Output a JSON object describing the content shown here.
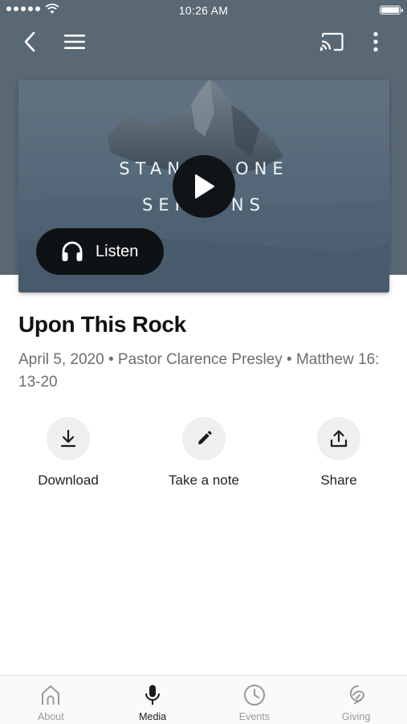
{
  "status_bar": {
    "time": "10:26 AM"
  },
  "hero": {
    "artwork_text": [
      "STANDALONE",
      "SERMONS"
    ],
    "listen_label": "Listen"
  },
  "sermon": {
    "title": "Upon This Rock",
    "meta": "April 5, 2020 • Pastor Clarence Presley • Matthew 16: 13-20"
  },
  "actions": [
    {
      "label": "Download",
      "icon": "download-icon"
    },
    {
      "label": "Take a note",
      "icon": "pencil-icon"
    },
    {
      "label": "Share",
      "icon": "share-icon"
    }
  ],
  "tabs": [
    {
      "label": "About",
      "icon": "church-icon",
      "active": false
    },
    {
      "label": "Media",
      "icon": "microphone-icon",
      "active": true
    },
    {
      "label": "Events",
      "icon": "clock-icon",
      "active": false
    },
    {
      "label": "Giving",
      "icon": "giving-icon",
      "active": false
    }
  ],
  "colors": {
    "header_background": "#5a6873",
    "button_dark": "#0f1215",
    "action_circle": "#eeeff1",
    "tab_active": "#1b1b1b",
    "tab_inactive": "#9a9a9a"
  }
}
